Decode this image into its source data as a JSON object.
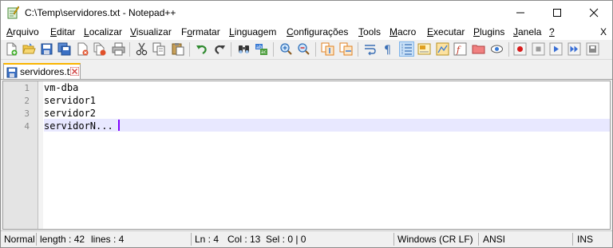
{
  "window": {
    "title": "C:\\Temp\\servidores.txt - Notepad++",
    "controls": [
      "minimize-icon",
      "maximize-icon",
      "close-icon"
    ]
  },
  "menu": {
    "items": [
      {
        "pre": "",
        "u": "A",
        "post": "rquivo"
      },
      {
        "pre": "",
        "u": "E",
        "post": "ditar"
      },
      {
        "pre": "",
        "u": "L",
        "post": "ocalizar"
      },
      {
        "pre": "",
        "u": "V",
        "post": "isualizar"
      },
      {
        "pre": "F",
        "u": "o",
        "post": "rmatar"
      },
      {
        "pre": "",
        "u": "L",
        "post": "inguagem"
      },
      {
        "pre": "",
        "u": "C",
        "post": "onfigurações"
      },
      {
        "pre": "",
        "u": "T",
        "post": "ools"
      },
      {
        "pre": "",
        "u": "M",
        "post": "acro"
      },
      {
        "pre": "",
        "u": "E",
        "post": "xecutar"
      },
      {
        "pre": "",
        "u": "P",
        "post": "lugins"
      },
      {
        "pre": "",
        "u": "J",
        "post": "anela"
      },
      {
        "pre": "",
        "u": "?",
        "post": ""
      }
    ],
    "close": "X"
  },
  "toolbar": {
    "icons": [
      "new-file-icon",
      "open-file-icon",
      "save-icon",
      "save-all-icon",
      "close-file-icon",
      "close-all-icon",
      "print-icon",
      "cut-icon",
      "copy-icon",
      "paste-icon",
      "undo-icon",
      "redo-icon",
      "find-icon",
      "replace-icon",
      "zoom-in-icon",
      "zoom-out-icon",
      "sync-vertical-icon",
      "sync-horizontal-icon",
      "word-wrap-icon",
      "show-all-chars-icon",
      "indent-guide-icon",
      "user-language-icon",
      "document-map-icon",
      "function-list-icon",
      "folder-workspace-icon",
      "monitor-icon",
      "record-macro-icon",
      "stop-macro-icon",
      "play-macro-icon",
      "run-macro-multiple-icon",
      "save-macro-icon"
    ]
  },
  "tabs": [
    {
      "label": "servidores.txt",
      "icon": "saved-file-icon"
    }
  ],
  "editor": {
    "lines": [
      {
        "num": "1",
        "text": "vm-dba"
      },
      {
        "num": "2",
        "text": "servidor1"
      },
      {
        "num": "3",
        "text": "servidor2"
      },
      {
        "num": "4",
        "text": "servidorN..."
      }
    ],
    "current_line": 4,
    "current_line_color": "#e8e8ff",
    "caret_color": "#8000ff"
  },
  "status": {
    "type": "Normal",
    "length": "length : 42",
    "lines": "lines : 4",
    "ln": "Ln : 4",
    "col": "Col : 13",
    "sel": "Sel : 0 | 0",
    "eol": "Windows (CR LF)",
    "encoding": "ANSI",
    "mode": "INS"
  }
}
